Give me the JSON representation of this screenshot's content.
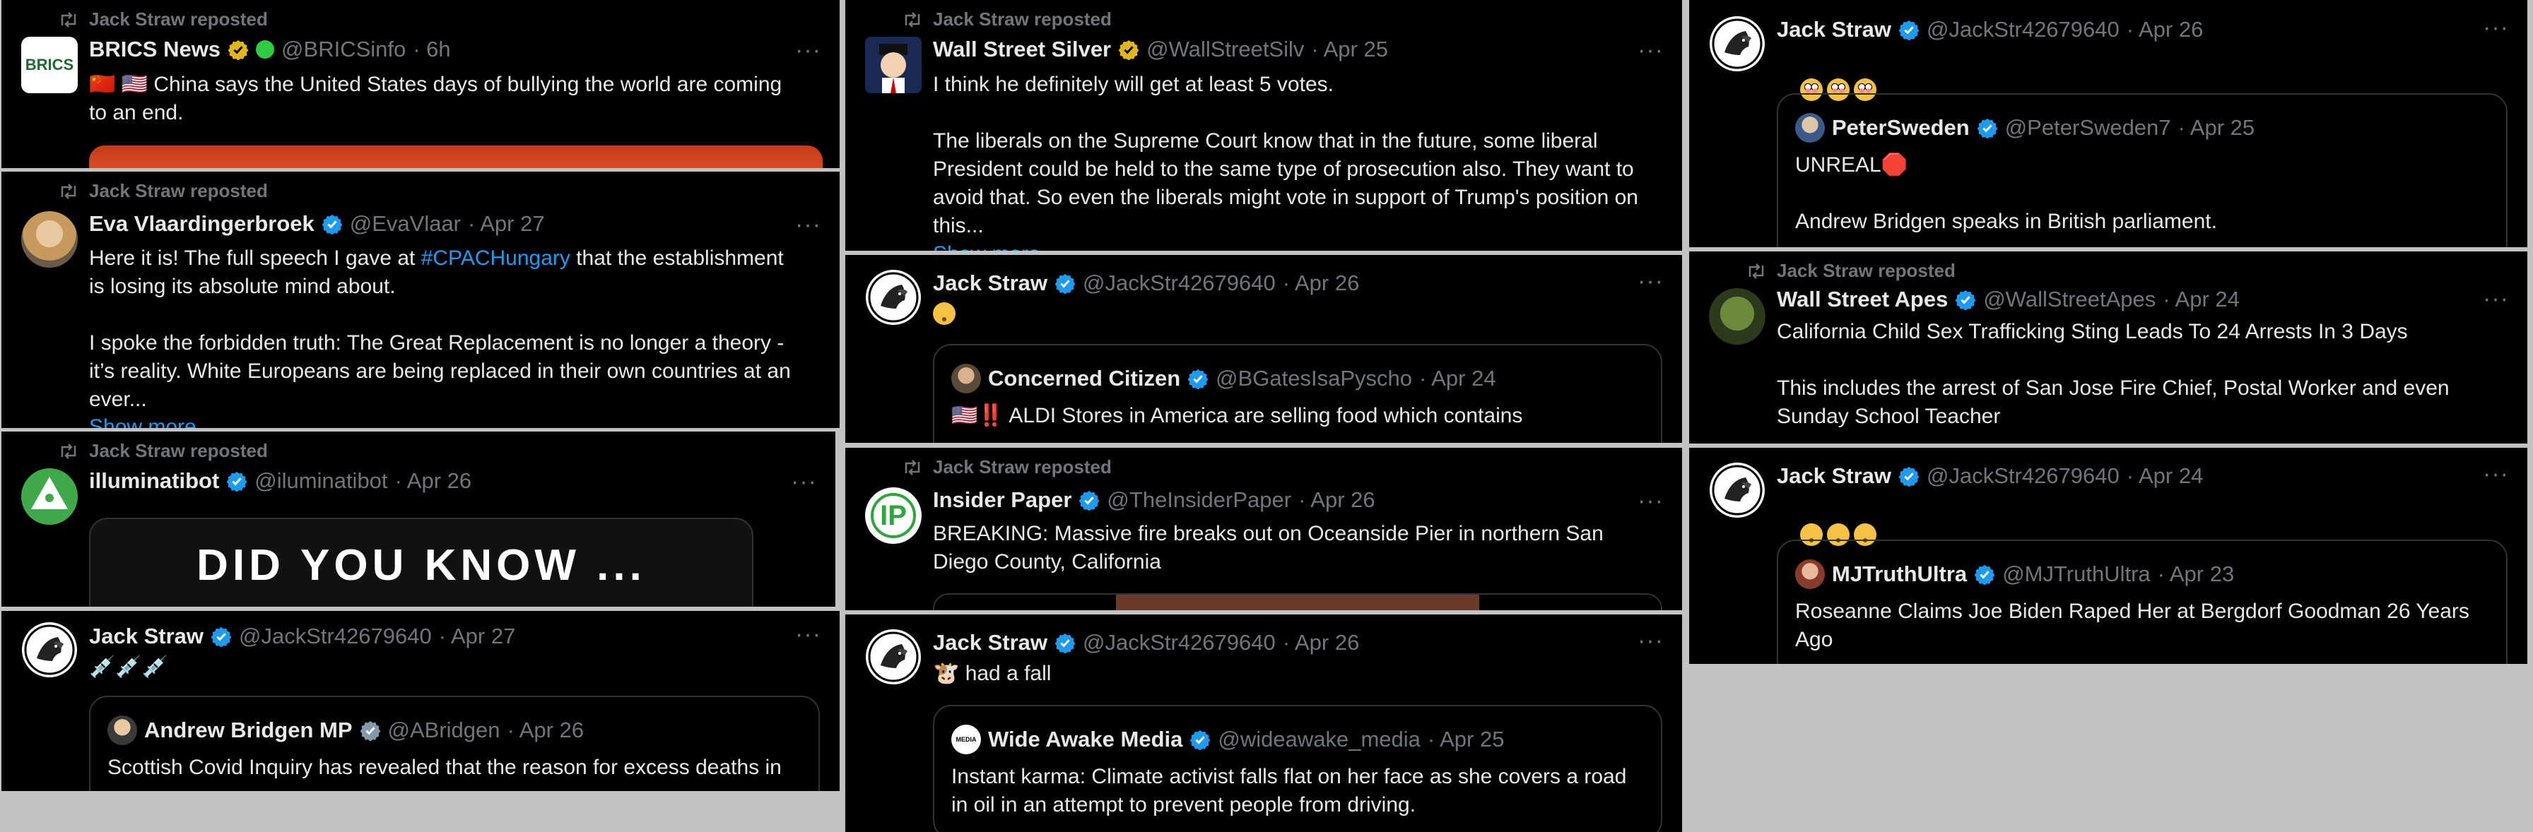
{
  "repost_label": "Jack Straw reposted",
  "more": "···",
  "tweets": [
    {
      "name": "BRICS News",
      "handle": "@BRICSinfo",
      "time": "· 6h",
      "avatar_text": "BRICS",
      "text": "🇨🇳 🇺🇸 China says the United States days of bullying the world are coming\nto an end."
    },
    {
      "name": "Eva Vlaardingerbroek",
      "handle": "@EvaVlaar",
      "time": "· Apr 27",
      "text_before": "Here it is! The full speech I gave at ",
      "hashtag": "#CPACHungary",
      "text_after": " that the establishment\nis losing its absolute mind about.\n\nI spoke the forbidden truth: The Great Replacement is no longer a theory -\nit’s reality. White Europeans are being replaced in their own countries at an\never...",
      "show_more": "Show more"
    },
    {
      "name": "illuminatibot",
      "handle": "@iluminatibot",
      "time": "· Apr 26",
      "media_text": "DID YOU KNOW ..."
    },
    {
      "name": "Jack Straw",
      "handle": "@JackStr42679640",
      "time": "· Apr 27",
      "text": "💉💉💉",
      "quote": {
        "name": "Andrew Bridgen MP",
        "handle": "@ABridgen",
        "time": "· Apr 26",
        "text": "Scottish Covid Inquiry has revealed that the reason for excess deaths in"
      }
    },
    {
      "name": "Wall Street Silver",
      "handle": "@WallStreetSilv",
      "time": "· Apr 25",
      "text": "I think he definitely will get at least 5 votes.\n\nThe liberals on the Supreme Court know that in the future, some liberal\nPresident could be held to the same type of prosecution also. They want to\navoid that. So even the liberals might vote in support of Trump's position on\nthis...",
      "show_more": "Show more"
    },
    {
      "name": "Jack Straw",
      "handle": "@JackStr42679640",
      "time": "· Apr 26",
      "emoji": "tired",
      "quote": {
        "name": "Concerned Citizen",
        "handle": "@BGatesIsaPyscho",
        "time": "· Apr 24",
        "text": "🇺🇸‼️ ALDI Stores in America are selling food which contains"
      }
    },
    {
      "name": "Insider Paper",
      "handle": "@TheInsiderPaper",
      "time": "· Apr 26",
      "avatar_text": "IP",
      "text": "BREAKING: Massive fire breaks out on Oceanside Pier in northern San\nDiego County, California"
    },
    {
      "name": "Jack Straw",
      "handle": "@JackStr42679640",
      "time": "· Apr 26",
      "text": "🐮 had a fall",
      "quote": {
        "name": "Wide Awake Media",
        "handle": "@wideawake_media",
        "time": "· Apr 25",
        "avatar_text": "MEDIA",
        "text": "Instant karma: Climate activist falls flat on her face as she covers a road\nin oil in an attempt to prevent people from driving."
      }
    },
    {
      "name": "Jack Straw",
      "handle": "@JackStr42679640",
      "time": "· Apr 26",
      "emoji": "flushed",
      "emoji_count": 3,
      "quote": {
        "name": "PeterSweden",
        "handle": "@PeterSweden7",
        "time": "· Apr 25",
        "text": "UNREAL🛑\n\nAndrew Bridgen speaks in British parliament."
      }
    },
    {
      "name": "Wall Street Apes",
      "handle": "@WallStreetApes",
      "time": "· Apr 24",
      "text": "California Child Sex Trafficking Sting Leads To 24 Arrests In 3 Days\n\nThis includes the arrest of San Jose Fire Chief, Postal Worker and even\nSunday School Teacher"
    },
    {
      "name": "Jack Straw",
      "handle": "@JackStr42679640",
      "time": "· Apr 24",
      "emoji": "tired",
      "emoji_count": 3,
      "quote": {
        "name": "MJTruthUltra",
        "handle": "@MJTruthUltra",
        "time": "· Apr 23",
        "text": "Roseanne Claims Joe Biden Raped Her at Bergdorf Goodman 26 Years\nAgo"
      }
    }
  ],
  "colors": {
    "bg": "#000000",
    "verified": "#1d9bf0",
    "gold": "#e2b719",
    "muted": "#71767b"
  }
}
